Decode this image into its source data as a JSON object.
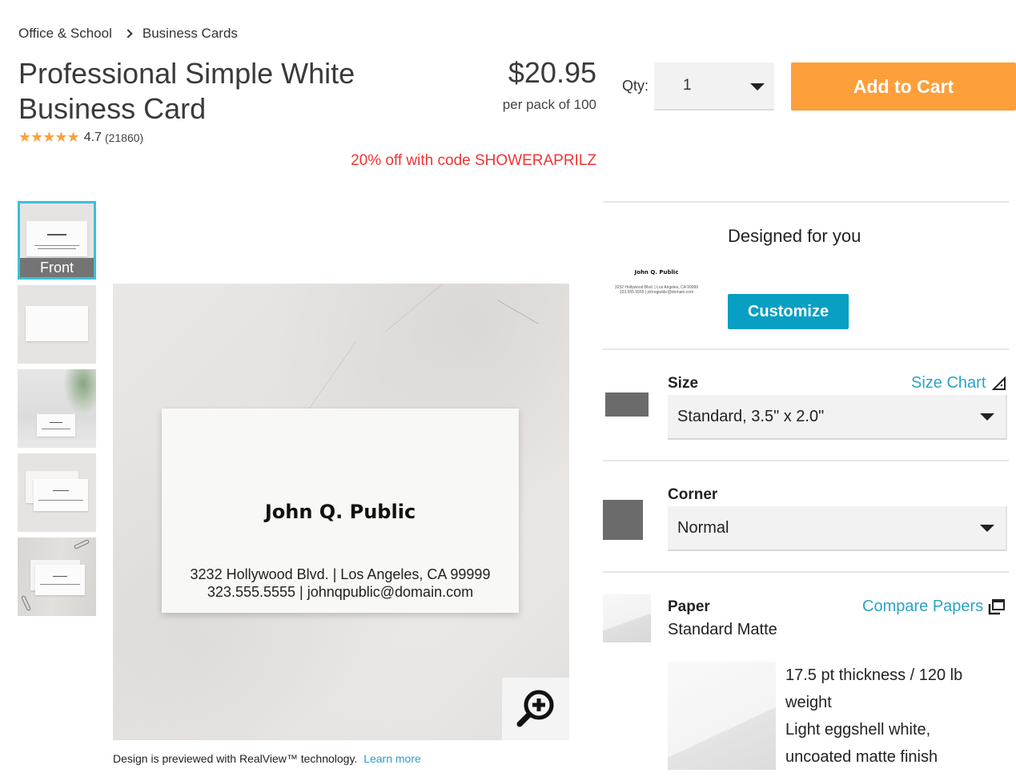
{
  "breadcrumb": [
    "Office & School",
    "Business Cards"
  ],
  "product": {
    "title": "Professional Simple White Business Card",
    "rating": "4.7",
    "review_count": "(21860)",
    "stars_filled": 5,
    "stars_max": 5
  },
  "pricing": {
    "price": "$20.95",
    "per_pack": "per pack of 100",
    "promo": "20% off with code SHOWERAPRILZ",
    "promo_color": "#ef3434"
  },
  "purchase": {
    "qty_label": "Qty:",
    "qty_value": "1",
    "add_to_cart": "Add to Cart",
    "cart_color": "#fd9f3b"
  },
  "thumbnails": [
    {
      "label": "Front",
      "active": true
    },
    {
      "label": "",
      "active": false
    },
    {
      "label": "",
      "active": false
    },
    {
      "label": "",
      "active": false
    },
    {
      "label": "",
      "active": false
    }
  ],
  "preview": {
    "card_name": "John Q. Public",
    "card_address": "3232 Hollywood Blvd. | Los Angeles, CA 99999",
    "card_contact": "323.555.5555 | johnqpublic@domain.com",
    "zoom_icon": "zoom-in-icon"
  },
  "realview": {
    "text": "Design is previewed with RealView™ technology.",
    "link": "Learn more"
  },
  "designed": {
    "title": "Designed for you",
    "thumb_name": "John Q. Public",
    "thumb_address": "3232 Hollywood Blvd. | Los Angeles, CA 99999",
    "thumb_contact": "323.555.5555 | johnqpublic@domain.com",
    "customize": "Customize",
    "accent": "#079fc3"
  },
  "options": {
    "size": {
      "label": "Size",
      "link": "Size Chart",
      "value": "Standard, 3.5\" x 2.0\""
    },
    "corner": {
      "label": "Corner",
      "value": "Normal"
    },
    "paper": {
      "label": "Paper",
      "link": "Compare Papers",
      "value": "Standard Matte",
      "desc_line1": "17.5 pt thickness / 120 lb weight",
      "desc_line2": "Light eggshell white, uncoated matte finish"
    },
    "link_color": "#2aa3c7"
  }
}
